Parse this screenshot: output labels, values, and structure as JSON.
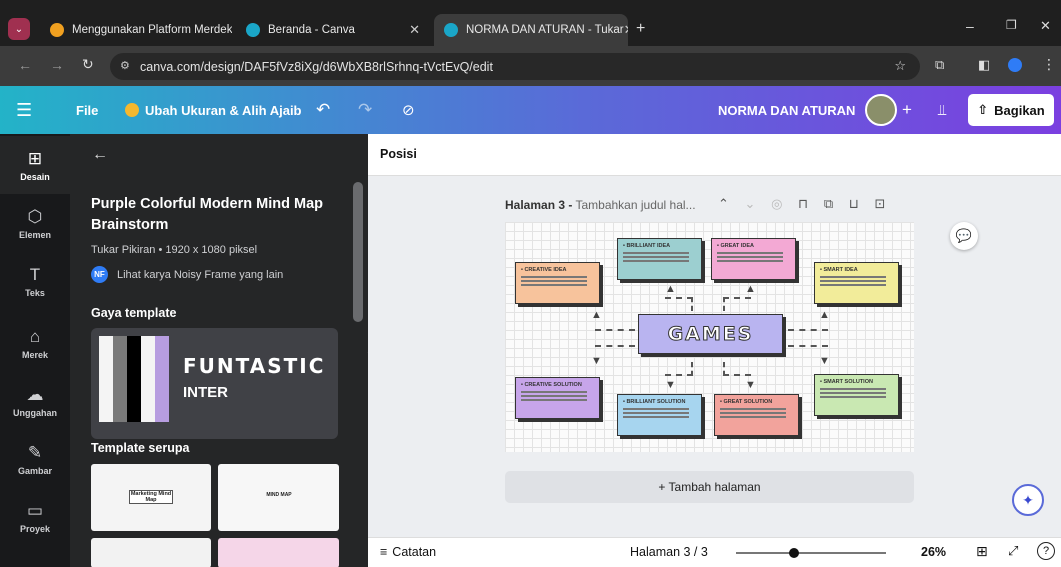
{
  "browser": {
    "tabs": [
      {
        "label": "Menggunakan Platform Merdek",
        "active": false
      },
      {
        "label": "Beranda - Canva",
        "active": false
      },
      {
        "label": "NORMA DAN ATURAN - Tukar",
        "active": true
      }
    ],
    "url": "canva.com/design/DAF5fVz8iXg/d6WbXB8rlSrhnq-tVctEvQ/edit"
  },
  "header": {
    "file_label": "File",
    "resize_label": "Ubah Ukuran & Alih Ajaib",
    "doc_title": "NORMA DAN ATURAN",
    "share_label": "Bagikan"
  },
  "rail": {
    "items": [
      {
        "label": "Desain",
        "icon": "layout-icon"
      },
      {
        "label": "Elemen",
        "icon": "shapes-icon"
      },
      {
        "label": "Teks",
        "icon": "text-icon"
      },
      {
        "label": "Merek",
        "icon": "brand-icon"
      },
      {
        "label": "Unggahan",
        "icon": "upload-icon"
      },
      {
        "label": "Gambar",
        "icon": "draw-icon"
      },
      {
        "label": "Proyek",
        "icon": "folder-icon"
      }
    ]
  },
  "panel": {
    "template_title": "Purple Colorful Modern Mind Map Brainstorm",
    "template_meta": "Tukar Pikiran • 1920 x 1080 piksel",
    "author_initials": "NF",
    "author_link": "Lihat karya Noisy Frame yang lain",
    "style_heading": "Gaya template",
    "style_font_1": "FUNTASTIC",
    "style_font_2": "INTER",
    "similar_heading": "Template serupa",
    "thumb_1": "Marketing Mind Map",
    "thumb_2": "MIND MAP"
  },
  "canvas": {
    "position_label": "Posisi",
    "page_label": "Halaman 3 -",
    "page_title_placeholder": "Tambahkan judul hal...",
    "center": "GAMES",
    "nodes": [
      "• CREATIVE IDEA",
      "• BRILLIANT IDEA",
      "• GREAT IDEA",
      "• SMART IDEA",
      "• CREATIVE SOLUTION",
      "• BRILLIANT SOLUTION",
      "• GREAT SOLUTION",
      "• SMART SOLUTION"
    ],
    "add_page": "+ Tambah halaman"
  },
  "footer": {
    "notes_label": "Catatan",
    "page_indicator": "Halaman 3 / 3",
    "zoom": "26%",
    "zoom_level": 0.26
  },
  "colors": {
    "chrome_bg": "#1f1f1f",
    "panel_bg": "#252627",
    "accent": "#7b3fe0"
  }
}
